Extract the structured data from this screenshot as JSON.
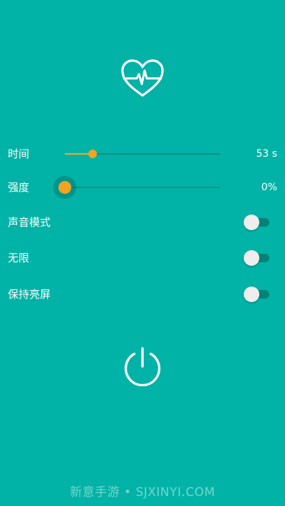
{
  "app": {
    "logo_icon": "heart-pulse-icon",
    "power_icon": "power-icon"
  },
  "sliders": [
    {
      "label": "时间",
      "value_text": "53 s",
      "fraction": 0.18
    },
    {
      "label": "强度",
      "value_text": "0%",
      "fraction": 0.0
    }
  ],
  "toggles": [
    {
      "label": "声音模式",
      "on": false
    },
    {
      "label": "无限",
      "on": false
    },
    {
      "label": "保持亮屏",
      "on": false
    }
  ],
  "watermark": "新意手游 • SJXINYI.COM",
  "colors": {
    "background": "#00b3a6",
    "accent": "#f5a623",
    "track": "#0b8f86",
    "switch_track": "#00847a"
  }
}
